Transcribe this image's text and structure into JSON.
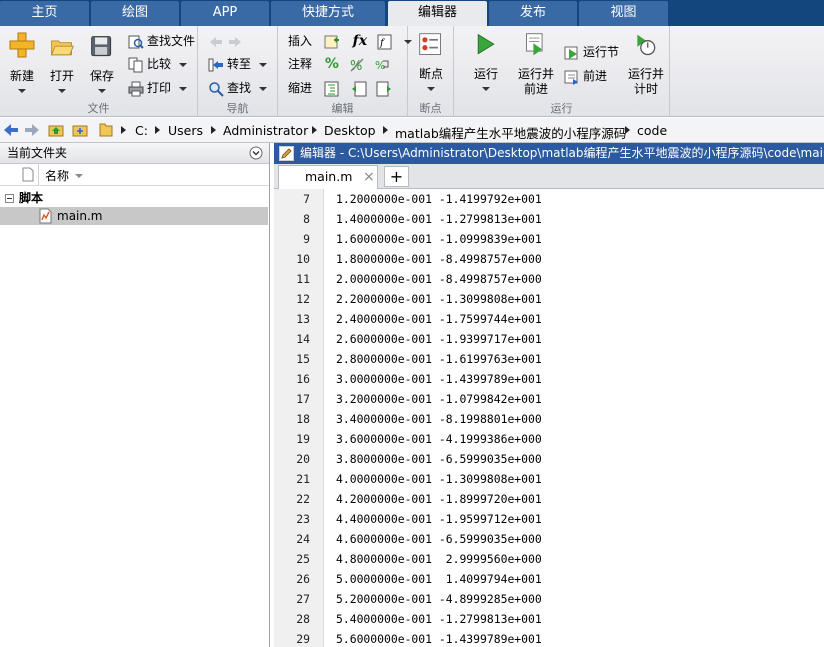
{
  "top_tabs": [
    {
      "label": "主页",
      "active": false
    },
    {
      "label": "绘图",
      "active": false
    },
    {
      "label": "APP",
      "active": false
    },
    {
      "label": "快捷方式",
      "active": false
    },
    {
      "label": "编辑器",
      "active": true
    },
    {
      "label": "发布",
      "active": false
    },
    {
      "label": "视图",
      "active": false
    }
  ],
  "ribbon": {
    "file": {
      "group_label": "文件",
      "new_label": "新建",
      "open_label": "打开",
      "save_label": "保存",
      "find_files_label": "查找文件",
      "compare_label": "比较",
      "print_label": "打印"
    },
    "navigate": {
      "group_label": "导航",
      "goto_label": "转至",
      "find_label": "查找"
    },
    "edit": {
      "group_label": "编辑",
      "insert_label": "插入",
      "comment_label": "注释",
      "indent_label": "缩进",
      "fx_label": "fx"
    },
    "breakpoints": {
      "group_label": "断点",
      "breakpoints_label": "断点"
    },
    "run": {
      "group_label": "运行",
      "run_label": "运行",
      "run_advance_label_1": "运行并",
      "run_advance_label_2": "前进",
      "run_section_label": "运行节",
      "advance_label": "前进",
      "run_time_label_1": "运行并",
      "run_time_label_2": "计时"
    }
  },
  "address_bar": {
    "crumbs": [
      "C:",
      "Users",
      "Administrator",
      "Desktop",
      "matlab编程产生水平地震波的小程序源码",
      "code"
    ]
  },
  "left_panel": {
    "title": "当前文件夹",
    "name_column": "名称",
    "group_label": "脚本",
    "file_name": "main.m"
  },
  "editor": {
    "title": "编辑器 - C:\\Users\\Administrator\\Desktop\\matlab编程产生水平地震波的小程序源码\\code\\main.m",
    "tab_label": "main.m",
    "tab_close": "×",
    "add_tab": "+",
    "lines": [
      {
        "num": "7",
        "text": "1.2000000e-001 -1.4199792e+001"
      },
      {
        "num": "8",
        "text": "1.4000000e-001 -1.2799813e+001"
      },
      {
        "num": "9",
        "text": "1.6000000e-001 -1.0999839e+001"
      },
      {
        "num": "10",
        "text": "1.8000000e-001 -8.4998757e+000"
      },
      {
        "num": "11",
        "text": "2.0000000e-001 -8.4998757e+000"
      },
      {
        "num": "12",
        "text": "2.2000000e-001 -1.3099808e+001"
      },
      {
        "num": "13",
        "text": "2.4000000e-001 -1.7599744e+001"
      },
      {
        "num": "14",
        "text": "2.6000000e-001 -1.9399717e+001"
      },
      {
        "num": "15",
        "text": "2.8000000e-001 -1.6199763e+001"
      },
      {
        "num": "16",
        "text": "3.0000000e-001 -1.4399789e+001"
      },
      {
        "num": "17",
        "text": "3.2000000e-001 -1.0799842e+001"
      },
      {
        "num": "18",
        "text": "3.4000000e-001 -8.1998801e+000"
      },
      {
        "num": "19",
        "text": "3.6000000e-001 -4.1999386e+000"
      },
      {
        "num": "20",
        "text": "3.8000000e-001 -6.5999035e+000"
      },
      {
        "num": "21",
        "text": "4.0000000e-001 -1.3099808e+001"
      },
      {
        "num": "22",
        "text": "4.2000000e-001 -1.8999720e+001"
      },
      {
        "num": "23",
        "text": "4.4000000e-001 -1.9599712e+001"
      },
      {
        "num": "24",
        "text": "4.6000000e-001 -6.5999035e+000"
      },
      {
        "num": "25",
        "text": "4.8000000e-001  2.9999560e+000"
      },
      {
        "num": "26",
        "text": "5.0000000e-001  1.4099794e+001"
      },
      {
        "num": "27",
        "text": "5.2000000e-001 -4.8999285e+000"
      },
      {
        "num": "28",
        "text": "5.4000000e-001 -1.2799813e+001"
      },
      {
        "num": "29",
        "text": "5.6000000e-001 -1.4399789e+001"
      }
    ]
  },
  "colors": {
    "tabbar_bg": "#14467e",
    "tab_bg": "#3a6aa6",
    "editor_title_bg": "#2c5aa0",
    "selection_bg": "#c8c8c8"
  }
}
